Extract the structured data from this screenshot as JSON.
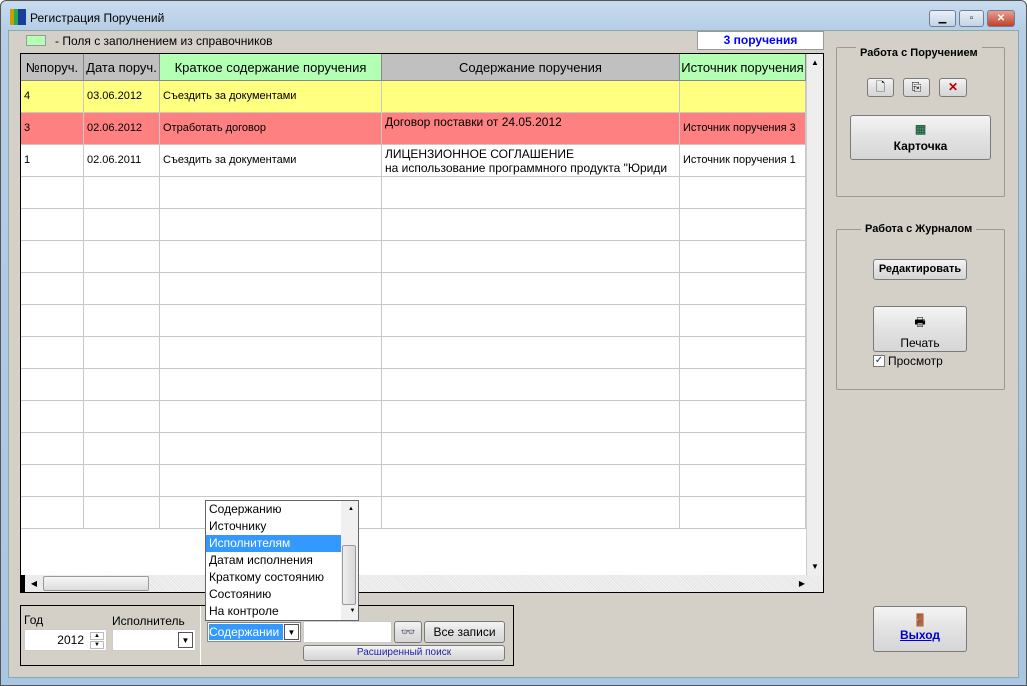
{
  "window": {
    "title": "Регистрация Поручений"
  },
  "legend": {
    "text": "- Поля с заполнением из справочников",
    "color": "#b3ffb3"
  },
  "count": "3 поручения",
  "grid": {
    "headers": [
      "№поруч.",
      "Дата поруч.",
      "Краткое содержание поручения",
      "Содержание поручения",
      "Источник поручения"
    ],
    "rows": [
      {
        "num": "4",
        "date": "03.06.2012",
        "short": "Съездить за документами",
        "content": "",
        "content2": "",
        "source": "",
        "color": "#ffff80"
      },
      {
        "num": "3",
        "date": "02.06.2012",
        "short": "Отработать договор",
        "content": "Договор поставки от 24.05.2012",
        "content2": "",
        "source": "Источник поручения 3",
        "color": "#ff8080"
      },
      {
        "num": "1",
        "date": "02.06.2011",
        "short": "Съездить за документами",
        "content": "ЛИЦЕНЗИОННОЕ СОГЛАШЕНИЕ",
        "content2": "на использование программного продукта \"Юриди",
        "source": "Источник поручения 1",
        "color": "#ffffff"
      }
    ]
  },
  "panel1": {
    "title": "Работа с Поручением",
    "card": "Карточка"
  },
  "panel2": {
    "title": "Работа с Журналом",
    "edit": "Редактировать",
    "print": "Печать",
    "preview": "Просмотр",
    "preview_checked": true
  },
  "exit": "Выход",
  "filter": {
    "year_label": "Год",
    "year": "2012",
    "executor_label": "Исполнитель",
    "executor": "",
    "search_by": "Содержании",
    "search_text": "",
    "all_records": "Все записи",
    "advanced": "Расширенный поиск"
  },
  "dropdown": {
    "options": [
      "Содержанию",
      "Источнику",
      "Исполнителям",
      "Датам исполнения",
      "Краткому состоянию",
      "Состоянию",
      "На контроле"
    ],
    "selected": "Исполнителям"
  }
}
